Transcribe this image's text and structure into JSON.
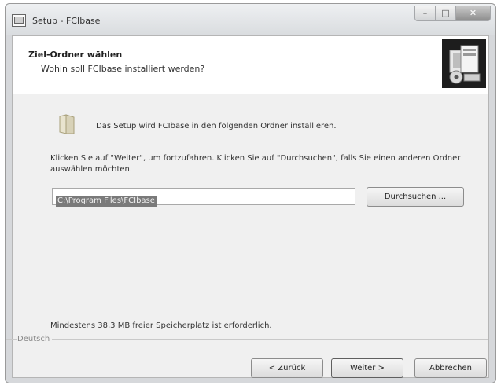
{
  "window": {
    "title": "Setup - FCIbase",
    "minimize_label": "–",
    "maximize_label": "□",
    "close_label": "✕"
  },
  "header": {
    "title": "Ziel-Ordner wählen",
    "subtitle": "Wohin soll FCIbase installiert werden?"
  },
  "body": {
    "intro": "Das Setup wird FCIbase in den folgenden Ordner installieren.",
    "instructions": "Klicken Sie auf \"Weiter\", um fortzufahren. Klicken Sie auf \"Durchsuchen\", falls Sie einen anderen Ordner auswählen möchten.",
    "path_value": "C:\\Program Files\\FCIbase",
    "browse_label": "Durchsuchen ...",
    "space_required": "Mindestens 38,3 MB freier Speicherplatz ist erforderlich."
  },
  "footer": {
    "language": "Deutsch",
    "back_label": "< Zurück",
    "next_label": "Weiter >",
    "cancel_label": "Abbrechen"
  },
  "icons": [
    "setup-app-icon",
    "wizard-logo-icon",
    "folder-icon"
  ]
}
